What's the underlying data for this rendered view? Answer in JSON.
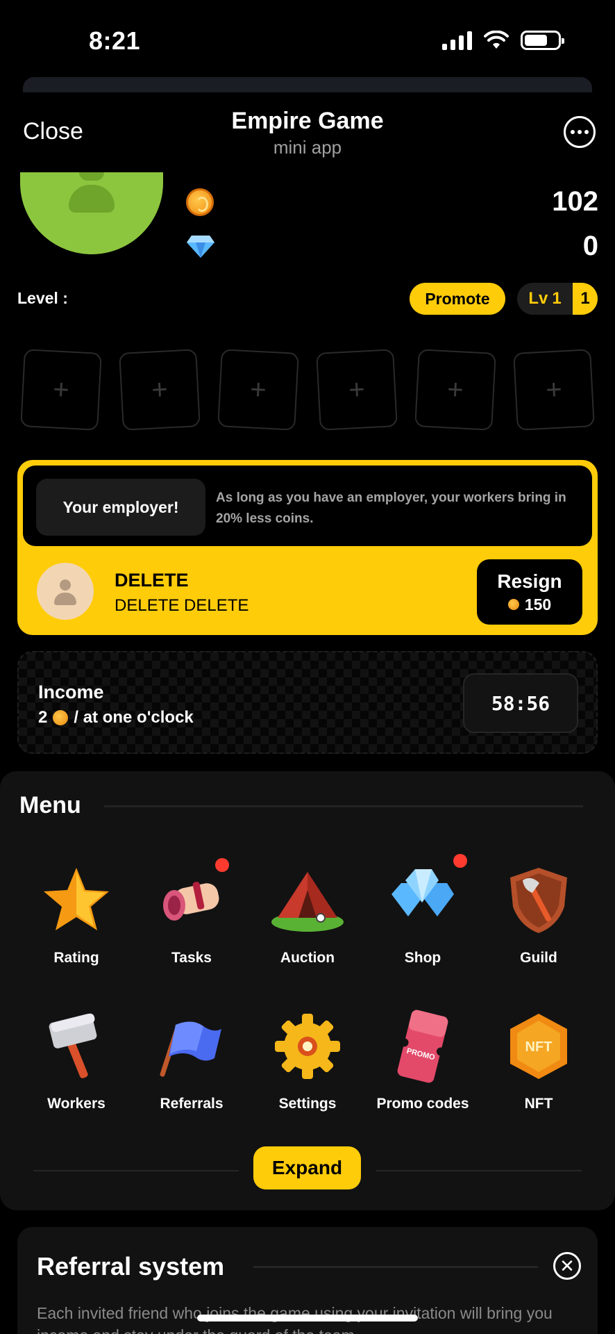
{
  "status_bar": {
    "time": "8:21"
  },
  "header": {
    "close_label": "Close",
    "title": "Empire Game",
    "subtitle": "mini app"
  },
  "profile": {
    "coins": "102",
    "gems": "0",
    "level_label": "Level :",
    "promote_label": "Promote",
    "lv_prefix": "Lv",
    "lv_value": "1",
    "lv_badge_number": "1"
  },
  "slots": [
    "+",
    "+",
    "+",
    "+",
    "+",
    "+"
  ],
  "employer": {
    "pill_label": "Your employer!",
    "note": "As long as you have an employer, your workers bring in 20% less coins.",
    "name": "DELETE",
    "subname": "DELETE DELETE",
    "resign_label": "Resign",
    "resign_cost": "150"
  },
  "income": {
    "title": "Income",
    "rate_value": "2",
    "rate_suffix": "/ at one o'clock",
    "timer": "58:56"
  },
  "menu": {
    "title": "Menu",
    "items": [
      {
        "label": "Rating",
        "icon": "star-icon",
        "badge": false
      },
      {
        "label": "Tasks",
        "icon": "scroll-icon",
        "badge": true
      },
      {
        "label": "Auction",
        "icon": "tent-icon",
        "badge": false
      },
      {
        "label": "Shop",
        "icon": "gems-icon",
        "badge": true
      },
      {
        "label": "Guild",
        "icon": "shield-axe-icon",
        "badge": false
      },
      {
        "label": "Workers",
        "icon": "hammer-icon",
        "badge": false
      },
      {
        "label": "Referrals",
        "icon": "flag-icon",
        "badge": false
      },
      {
        "label": "Settings",
        "icon": "gear-icon",
        "badge": false
      },
      {
        "label": "Promo codes",
        "icon": "ticket-icon",
        "badge": false
      },
      {
        "label": "NFT",
        "icon": "nft-badge-icon",
        "badge": false
      }
    ],
    "expand_label": "Expand",
    "nft_text": "NFT",
    "promo_text": "PROMO"
  },
  "referral": {
    "title": "Referral system",
    "close_symbol": "✕",
    "text": "Each invited friend who joins the game using your invitation will bring you income and stay under the guard of the team..."
  },
  "colors": {
    "accent": "#ffcc0a",
    "background": "#000000",
    "panel": "#121212",
    "notification": "#ff3b30"
  }
}
